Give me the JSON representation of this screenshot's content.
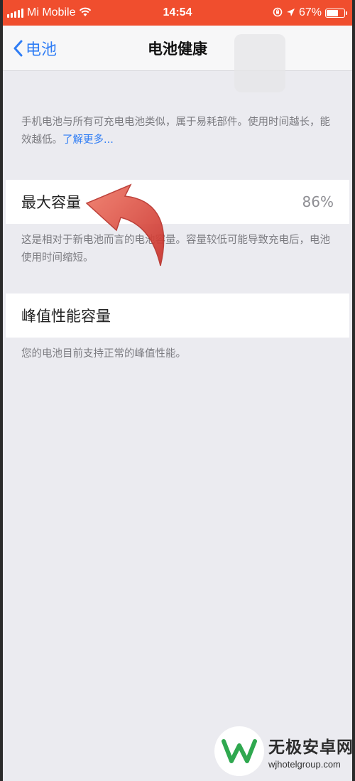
{
  "status_bar": {
    "carrier": "Mi Mobile",
    "time": "14:54",
    "battery_percent": "67%",
    "battery_level": 0.67,
    "background_color": "#f04e2e"
  },
  "nav": {
    "back_label": "电池",
    "title": "电池健康",
    "accent_color": "#2f7df5"
  },
  "intro": {
    "text": "手机电池与所有可充电电池类似，属于易耗部件。使用时间越长，能效越低。",
    "link": "了解更多..."
  },
  "max_capacity": {
    "label": "最大容量",
    "value": "86%",
    "description": "这是相对于新电池而言的电池容量。容量较低可能导致充电后，电池使用时间缩短。"
  },
  "peak_performance": {
    "label": "峰值性能容量",
    "description": "您的电池目前支持正常的峰值性能。"
  },
  "watermark": {
    "name": "无极安卓网",
    "url": "wjhotelgroup.com",
    "icon": "w-logo-icon"
  },
  "icons": [
    "signal-icon",
    "wifi-icon",
    "lock-rotation-icon",
    "location-icon",
    "battery-icon",
    "chevron-left-icon",
    "red-arrow-annotation"
  ]
}
